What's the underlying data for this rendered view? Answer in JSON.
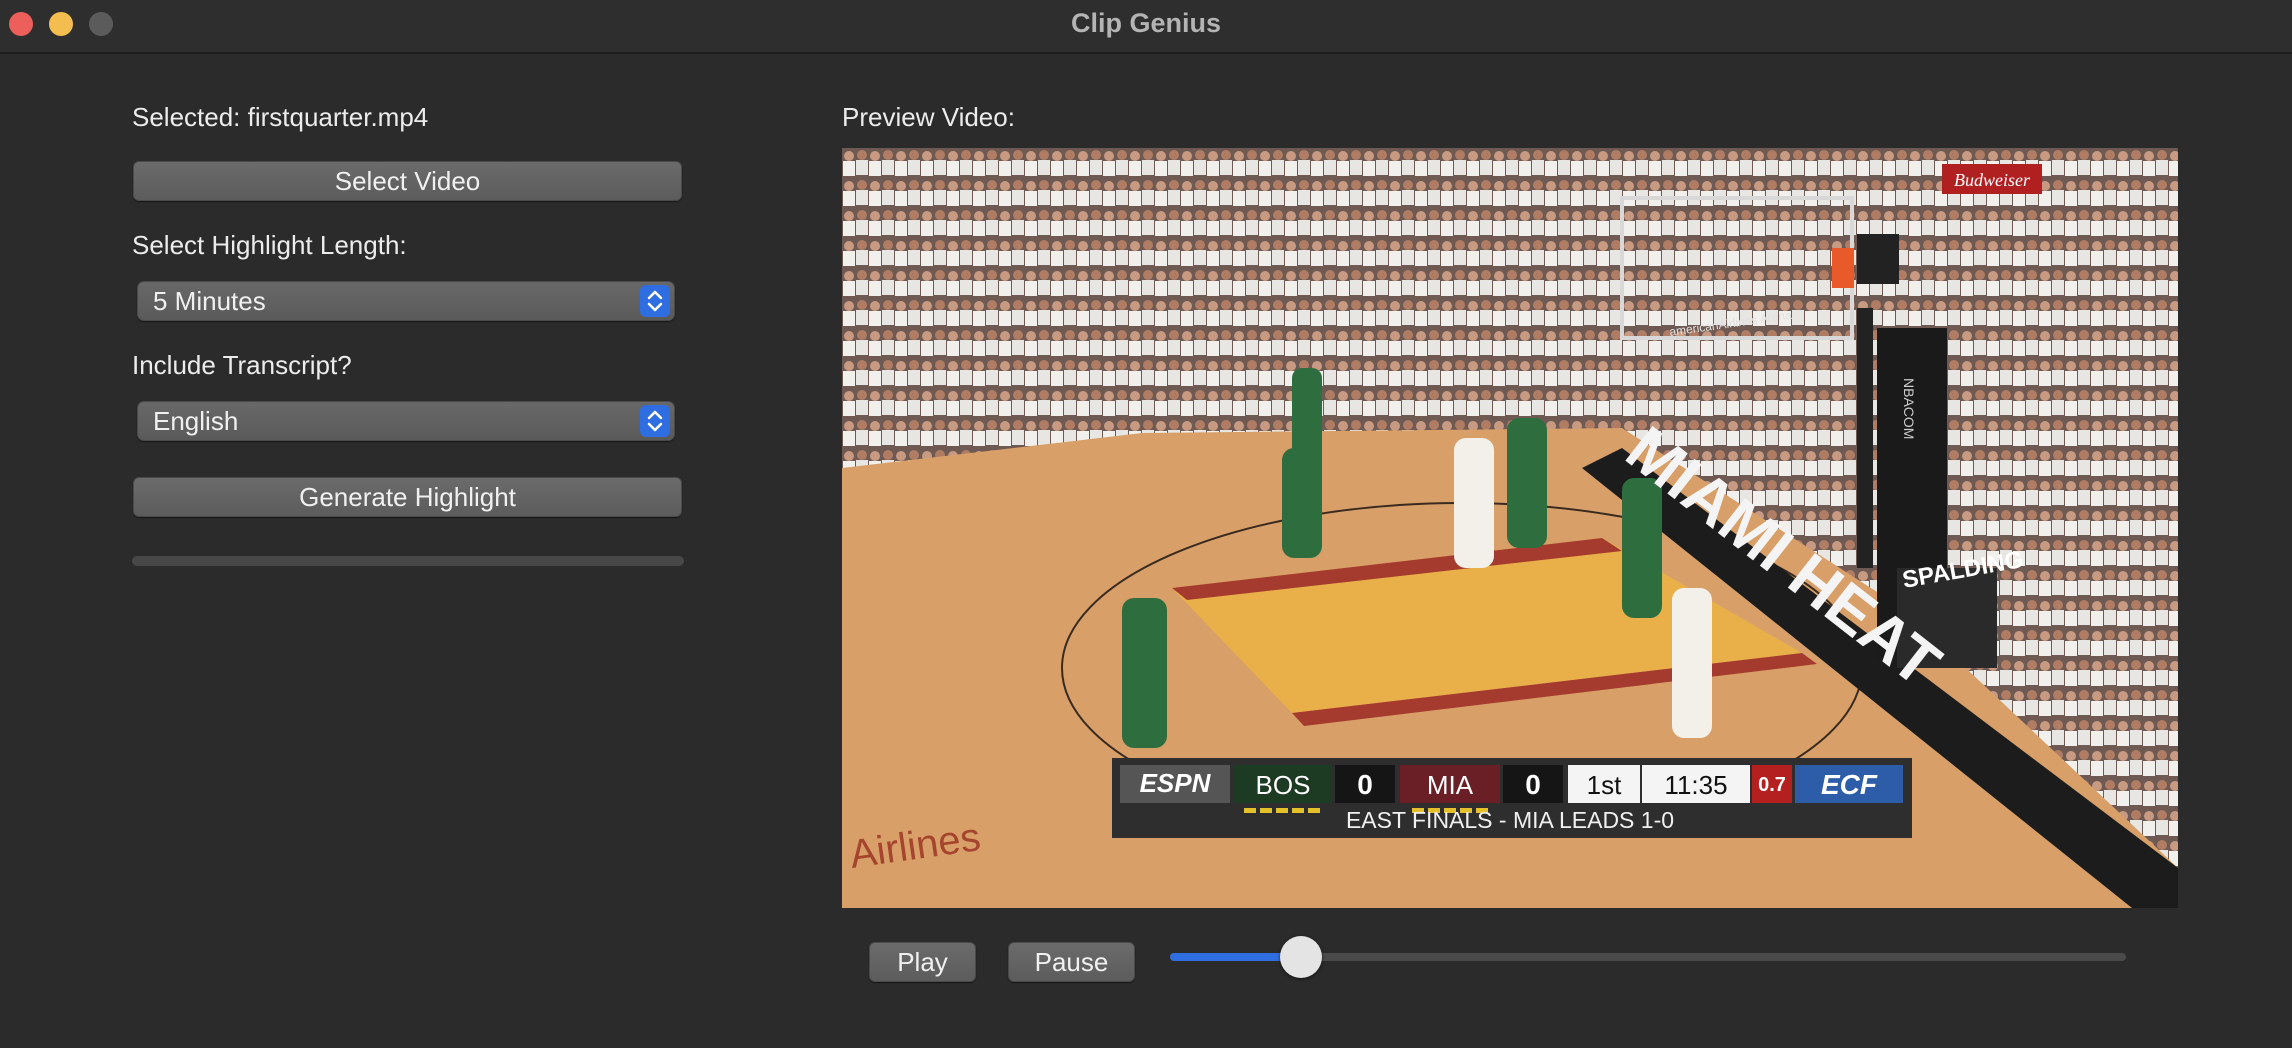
{
  "window": {
    "title": "Clip Genius"
  },
  "left_panel": {
    "selected_label": "Selected: firstquarter.mp4",
    "select_video_button": "Select Video",
    "highlight_length_label": "Select Highlight Length:",
    "highlight_length_value": "5 Minutes",
    "transcript_label": "Include Transcript?",
    "transcript_value": "English",
    "generate_button": "Generate Highlight",
    "progress": 0
  },
  "preview": {
    "label": "Preview Video:",
    "play_button": "Play",
    "pause_button": "Pause",
    "playback_position": 0.137,
    "scoreboard": {
      "network": "ESPN",
      "team1": "BOS",
      "score1": "0",
      "team2": "MIA",
      "score2": "0",
      "period": "1st",
      "clock": "11:35",
      "shot_clock": "0.7",
      "series_logo": "ECF",
      "ticker": "EAST FINALS - MIA LEADS 1-0"
    },
    "court_text": {
      "baseline": "MIAMI HEAT",
      "sideline": "Airlines",
      "stanchion_brand": "SPALDING",
      "stanchion_side": "NBACOM",
      "sign": "Budweiser",
      "arena": "americanAirlines Arena"
    }
  },
  "colors": {
    "background": "#2b2b2b",
    "accent": "#2f6ee0",
    "close": "#ec5f5a",
    "minimize": "#f4bd4f",
    "maximize": "#5b5b5b"
  }
}
